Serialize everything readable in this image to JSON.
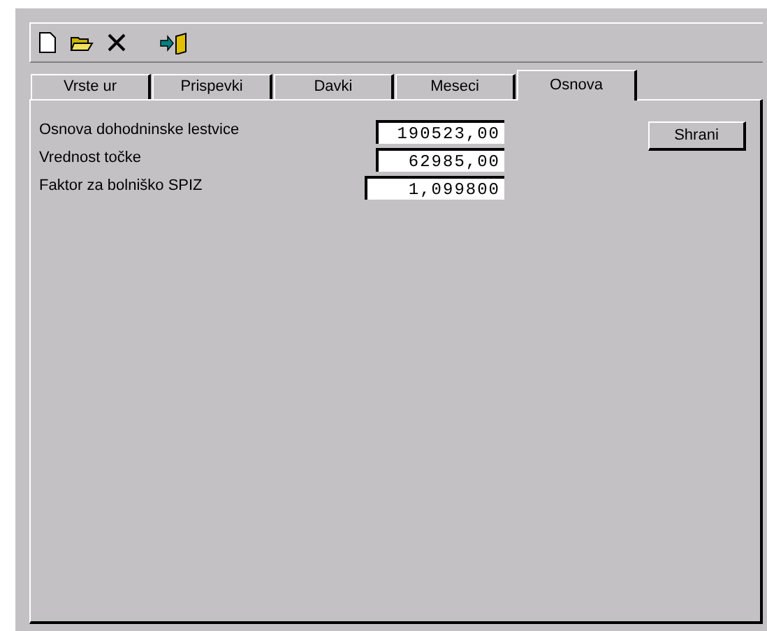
{
  "tabs": [
    {
      "label": "Vrste ur",
      "selected": false
    },
    {
      "label": "Prispevki",
      "selected": false
    },
    {
      "label": "Davki",
      "selected": false
    },
    {
      "label": "Meseci",
      "selected": false
    },
    {
      "label": "Osnova",
      "selected": true
    }
  ],
  "fields": [
    {
      "label": "Osnova dohodninske lestvice",
      "value": "190523,00",
      "wide": false
    },
    {
      "label": "Vrednost točke",
      "value": "62985,00",
      "wide": false
    },
    {
      "label": "Faktor za bolniško SPIZ",
      "value": "1,099800",
      "wide": true
    }
  ],
  "save_button": "Shrani"
}
